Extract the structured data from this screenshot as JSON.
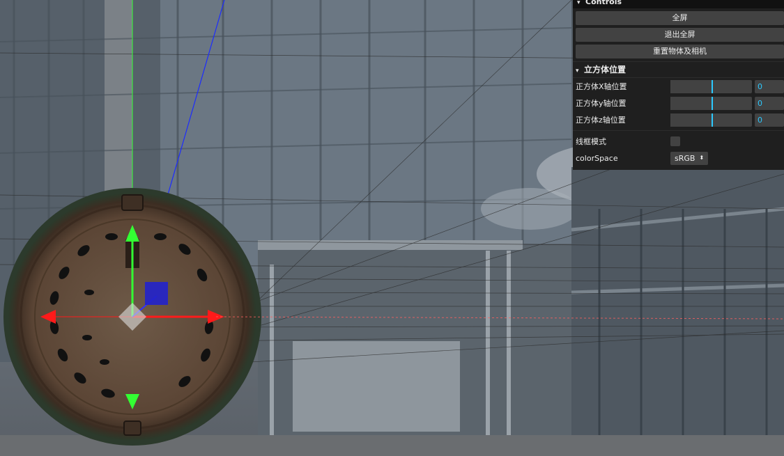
{
  "gui": {
    "title": "Controls",
    "buttons": [
      {
        "label": "全屏"
      },
      {
        "label": "退出全屏"
      },
      {
        "label": "重置物体及相机"
      }
    ],
    "folder": {
      "title": "立方体位置",
      "sliders": [
        {
          "label": "正方体X轴位置",
          "value": "0",
          "fraction": 0.5
        },
        {
          "label": "正方体y轴位置",
          "value": "0",
          "fraction": 0.5
        },
        {
          "label": "正方体z轴位置",
          "value": "0",
          "fraction": 0.5
        }
      ]
    },
    "wireframe": {
      "label": "线框模式",
      "checked": false
    },
    "colorSpace": {
      "label": "colorSpace",
      "value": "sRGB"
    },
    "accent_color": "#2cc9ff"
  }
}
